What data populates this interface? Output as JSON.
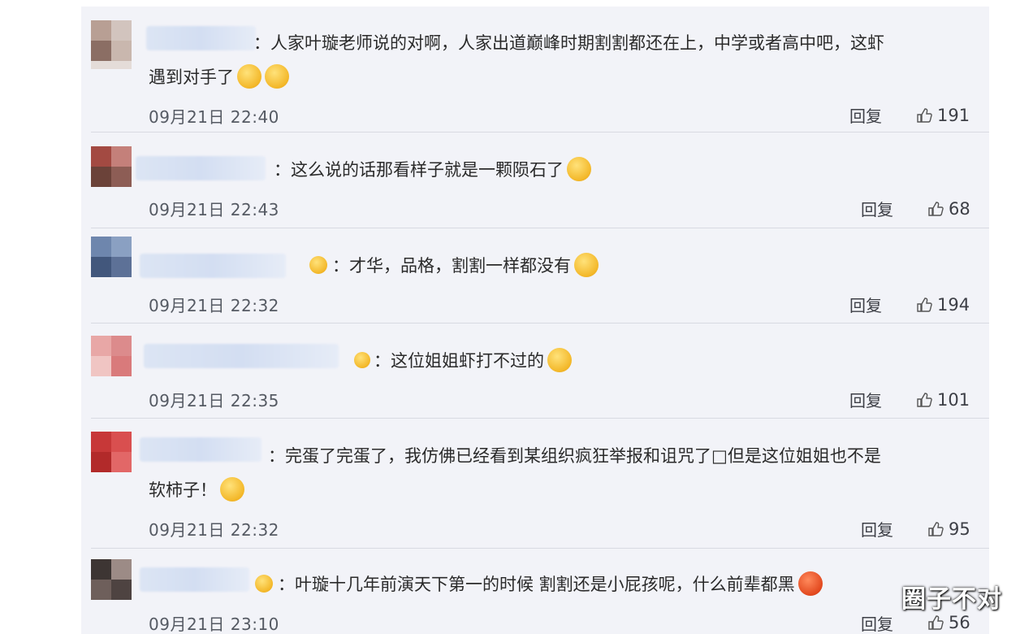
{
  "comments": [
    {
      "line1": "：人家叶璇老师说的对啊，人家出道巅峰时期割割都还在上，中学或者高中吧，这虾",
      "line2": "遇到对手了",
      "emoji": "laughing-tears-emoji x2",
      "time": "09月21日 22:40",
      "reply": "回复",
      "likes": "191"
    },
    {
      "line1": "：这么说的话那看样子就是一颗陨石了",
      "emoji": "sweat-emoji",
      "time": "09月21日 22:43",
      "reply": "回复",
      "likes": "68"
    },
    {
      "line1": "：才华，品格，割割一样都没有",
      "emoji": "thumbs-up-emoji",
      "time": "09月21日 22:32",
      "reply": "回复",
      "likes": "194"
    },
    {
      "line1": "：这位姐姐虾打不过的",
      "emoji": "crying-laugh-emoji",
      "time": "09月21日 22:35",
      "reply": "回复",
      "likes": "101"
    },
    {
      "line1": "：完蛋了完蛋了，我仿佛已经看到某组织疯狂举报和诅咒了□但是这位姐姐也不是",
      "line2": "软柿子！",
      "emoji": "shocked-emoji",
      "time": "09月21日 22:32",
      "reply": "回复",
      "likes": "95"
    },
    {
      "line1": "：叶璇十几年前演天下第一的时候 割割还是小屁孩呢，什么前辈都黑",
      "emoji": "angry-emoji",
      "time": "09月21日 23:10",
      "reply": "回复",
      "likes": "56"
    }
  ],
  "watermark": "圈子不对",
  "colors": {
    "panel": "#f2f3f8",
    "divider": "#d8dae2",
    "text": "#2a2a2a",
    "meta": "#555a63"
  }
}
